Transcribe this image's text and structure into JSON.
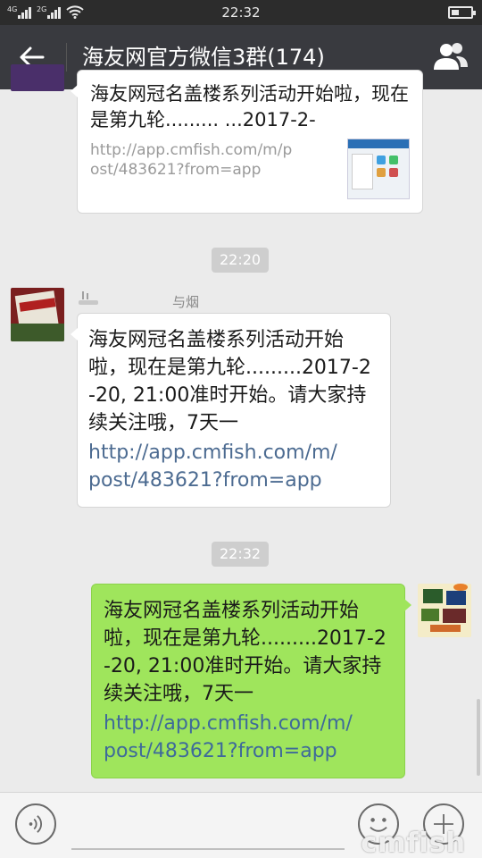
{
  "status_bar": {
    "time": "22:32",
    "net1": "4G",
    "net2": "2G"
  },
  "header": {
    "title": "海友网官方微信3群(174)"
  },
  "messages": {
    "m1": {
      "text": "海友网冠名盖楼系列活动开始啦，现在是第九轮.........  ...2017-2-",
      "link": "http://app.cmfish.com/m/post/483621?from=app"
    },
    "ts1": "22:20",
    "m2": {
      "sender": "与烟",
      "text": "海友网冠名盖楼系列活动开始啦，现在是第九轮.........2017-2-20, 21:00准时开始。请大家持续关注哦，7天一",
      "link": "http://app.cmfish.com/m/post/483621?from=app"
    },
    "ts2": "22:32",
    "m3": {
      "text": "海友网冠名盖楼系列活动开始啦，现在是第九轮.........2017-2-20, 21:00准时开始。请大家持续关注哦，7天一",
      "link": "http://app.cmfish.com/m/post/483621?from=app"
    }
  },
  "watermark": "cmfish",
  "colors": {
    "header_bg": "#393a3f",
    "chat_bg": "#ebebeb",
    "self_bubble": "#9fe55c",
    "link": "#4c6b91"
  },
  "icons": [
    "back-arrow-icon",
    "group-members-icon",
    "voice-icon",
    "emoji-icon",
    "plus-icon"
  ]
}
